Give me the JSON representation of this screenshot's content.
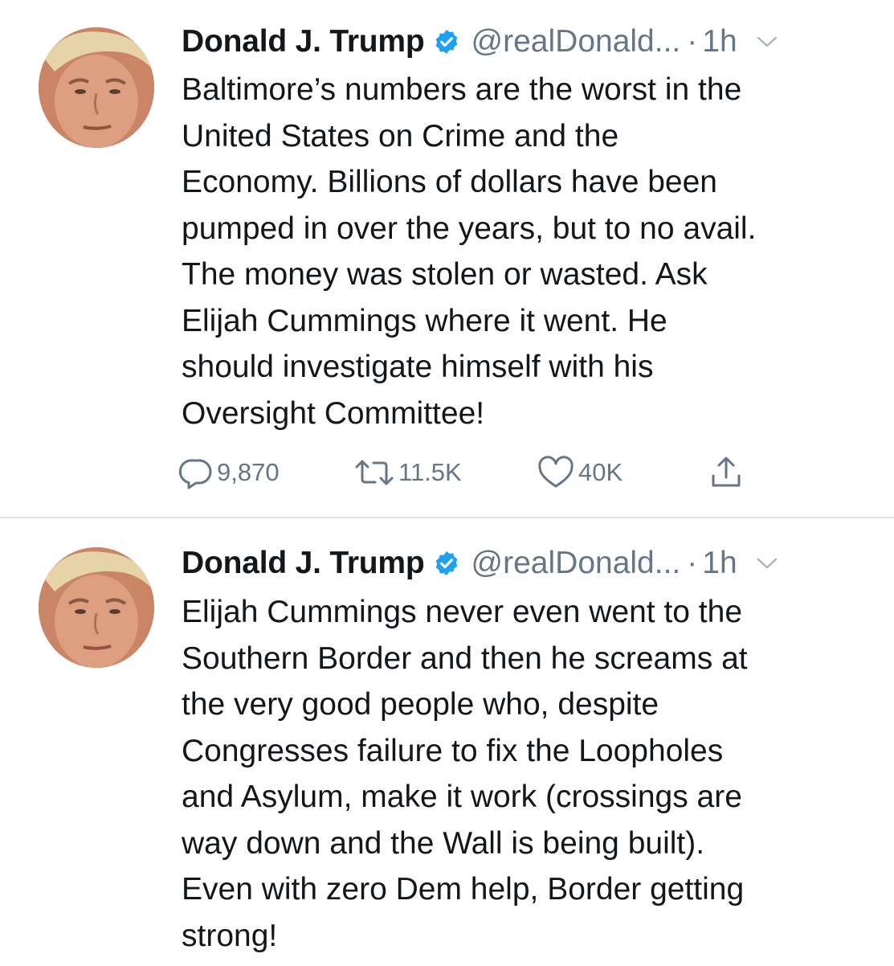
{
  "colors": {
    "text": "#14171a",
    "secondary": "#657786",
    "verified_blue": "#1da1f2",
    "divider": "#e1e8ed"
  },
  "tweets": [
    {
      "author_name": "Donald J. Trump",
      "handle": "@realDonald...",
      "separator": "·",
      "time": "1h",
      "avatar_icon": "profile-photo",
      "verified_icon": "verified-badge-icon",
      "menu_icon": "chevron-down-icon",
      "text": "Baltimore’s numbers are the worst in the\nUnited States on Crime and the\nEconomy. Billions of dollars have been\npumped in over the years, but to no avail.\nThe money was stolen or wasted. Ask\nElijah Cummings where it went. He\nshould investigate himself with his\nOversight Committee!",
      "actions": {
        "reply_count": "9,870",
        "retweet_count": "11.5K",
        "like_count": "40K",
        "reply_icon": "reply-icon",
        "retweet_icon": "retweet-icon",
        "like_icon": "heart-icon",
        "share_icon": "share-icon"
      }
    },
    {
      "author_name": "Donald J. Trump",
      "handle": "@realDonald...",
      "separator": "·",
      "time": "1h",
      "avatar_icon": "profile-photo",
      "verified_icon": "verified-badge-icon",
      "menu_icon": "chevron-down-icon",
      "text": "Elijah Cummings never even went to the\nSouthern Border and then he screams at\nthe very good people who, despite\nCongresses failure to fix the Loopholes\nand Asylum, make it work (crossings are\nway down and the Wall is being built).\nEven with zero Dem help, Border getting\nstrong!"
    }
  ]
}
